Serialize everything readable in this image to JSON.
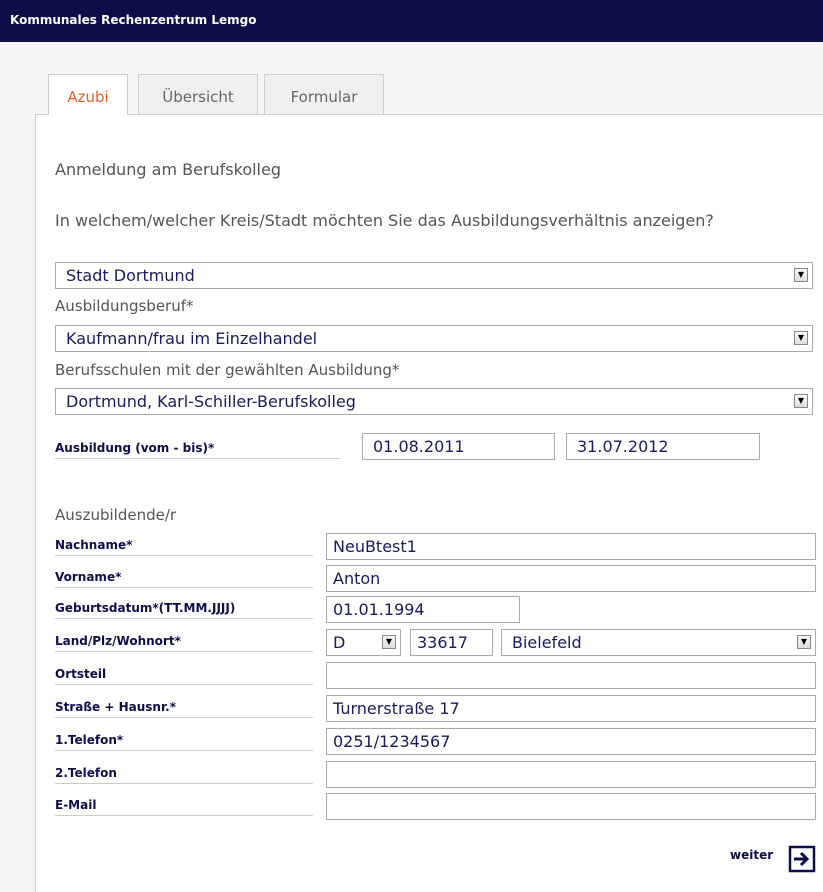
{
  "header": {
    "title": "Kommunales Rechenzentrum Lemgo"
  },
  "tabs": [
    {
      "label": "Azubi"
    },
    {
      "label": "Übersicht"
    },
    {
      "label": "Formular"
    }
  ],
  "form": {
    "section1_title": "Anmeldung am Berufskolleg",
    "question": "In welchem/welcher Kreis/Stadt möchten Sie das Ausbildungsverhältnis anzeigen?",
    "kreis_value": "Stadt Dortmund",
    "beruf_label": "Ausbildungsberuf*",
    "beruf_value": "Kaufmann/frau im Einzelhandel",
    "schule_label": "Berufsschulen mit der gewählten Ausbildung*",
    "schule_value": "Dortmund, Karl-Schiller-Berufskolleg",
    "ausbildung_label": "Ausbildung (vom - bis)*",
    "ausbildung_from": "01.08.2011",
    "ausbildung_to": "31.07.2012",
    "section2_title": "Auszubildende/r",
    "fields": {
      "nachname": {
        "label": "Nachname*",
        "value": "NeuBtest1"
      },
      "vorname": {
        "label": "Vorname*",
        "value": "Anton"
      },
      "geburtsdatum": {
        "label": "Geburtsdatum*(TT.MM.JJJJ)",
        "value": "01.01.1994"
      },
      "land_plz_ort": {
        "label": "Land/Plz/Wohnort*",
        "land": "D",
        "plz": "33617",
        "ort": "Bielefeld"
      },
      "ortsteil": {
        "label": "Ortsteil",
        "value": ""
      },
      "strasse": {
        "label": "Straße + Hausnr.*",
        "value": "Turnerstraße 17"
      },
      "telefon1": {
        "label": "1.Telefon*",
        "value": "0251/1234567"
      },
      "telefon2": {
        "label": "2.Telefon",
        "value": ""
      },
      "email": {
        "label": "E-Mail",
        "value": ""
      }
    },
    "next_label": "weiter"
  },
  "colors": {
    "header_bg": "#0d0d4a",
    "active_tab": "#e8602c",
    "label": "#0d0d4a",
    "value": "#1a1a5e"
  }
}
